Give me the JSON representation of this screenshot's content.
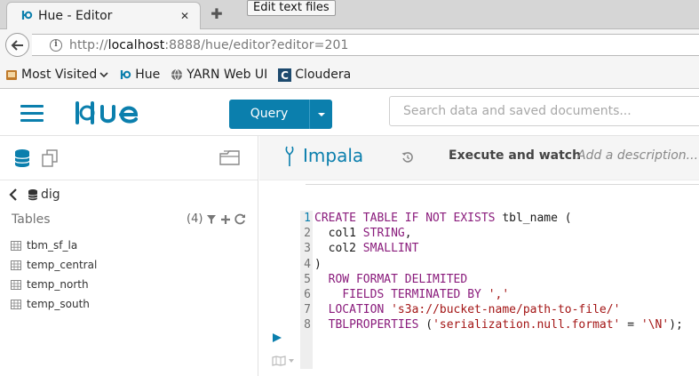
{
  "browser": {
    "tab_title": "Hue - Editor",
    "tooltip": "Edit text files",
    "url_prefix": "http://",
    "url_host": "localhost",
    "url_rest": ":8888/hue/editor?editor=201",
    "bookmarks": [
      {
        "label": "Most Visited",
        "icon": "gear-icon"
      },
      {
        "label": "Hue",
        "icon": "hue-icon"
      },
      {
        "label": "YARN Web UI",
        "icon": "globe-icon"
      },
      {
        "label": "Cloudera",
        "icon": "cloudera-icon"
      }
    ]
  },
  "header": {
    "query_label": "Query",
    "search_placeholder": "Search data and saved documents..."
  },
  "assist": {
    "database": "dig",
    "tables_label": "Tables",
    "tables_count": "(4)",
    "tables": [
      "tbm_sf_la",
      "temp_central",
      "temp_north",
      "temp_south"
    ]
  },
  "editor": {
    "engine": "Impala",
    "execute_label": "Execute and watch",
    "description_placeholder": "Add a description...",
    "active_line": 1
  },
  "colors": {
    "accent": "#0b7fad",
    "keyword": "#8a1c7c",
    "string": "#a31515"
  }
}
